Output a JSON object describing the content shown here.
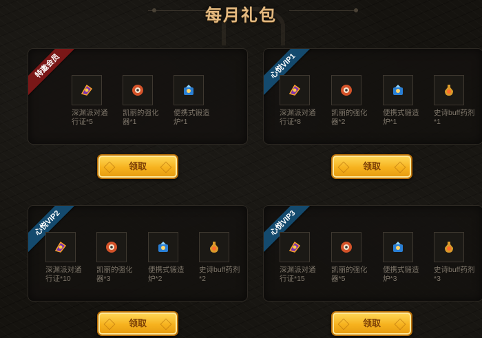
{
  "page": {
    "title": "每月礼包"
  },
  "items_catalog": {
    "pass": {
      "icon": "purple-pass-icon",
      "color": "#7d2fb0"
    },
    "enhancer": {
      "icon": "orange-gear-icon",
      "color": "#d4532a"
    },
    "forge": {
      "icon": "blue-forge-icon",
      "color": "#2a7fd4"
    },
    "potion": {
      "icon": "gold-potion-icon",
      "color": "#d99a2b"
    }
  },
  "panels": [
    {
      "badge": "特邀会员",
      "badge_color": "#7a1717",
      "items": [
        {
          "kind": "pass",
          "label": "深渊派对通行证*5"
        },
        {
          "kind": "enhancer",
          "label": "凯丽的强化器*1"
        },
        {
          "kind": "forge",
          "label": "便携式锻造炉*1"
        }
      ],
      "button": "领取"
    },
    {
      "badge": "心悦VIP1",
      "badge_color": "#144a6e",
      "items": [
        {
          "kind": "pass",
          "label": "深渊派对通行证*8"
        },
        {
          "kind": "enhancer",
          "label": "凯丽的强化器*2"
        },
        {
          "kind": "forge",
          "label": "便携式锻造炉*1"
        },
        {
          "kind": "potion",
          "label": "史诗buff药剂*1"
        }
      ],
      "button": "领取"
    },
    {
      "badge": "心悦VIP2",
      "badge_color": "#144a6e",
      "items": [
        {
          "kind": "pass",
          "label": "深渊派对通行证*10"
        },
        {
          "kind": "enhancer",
          "label": "凯丽的强化器*3"
        },
        {
          "kind": "forge",
          "label": "便携式锻造炉*2"
        },
        {
          "kind": "potion",
          "label": "史诗buff药剂*2"
        }
      ],
      "button": "领取"
    },
    {
      "badge": "心悦VIP3",
      "badge_color": "#144a6e",
      "items": [
        {
          "kind": "pass",
          "label": "深渊派对通行证*15"
        },
        {
          "kind": "enhancer",
          "label": "凯丽的强化器*5"
        },
        {
          "kind": "forge",
          "label": "便携式锻造炉*3"
        },
        {
          "kind": "potion",
          "label": "史诗buff药剂*3"
        }
      ],
      "button": "领取"
    }
  ]
}
